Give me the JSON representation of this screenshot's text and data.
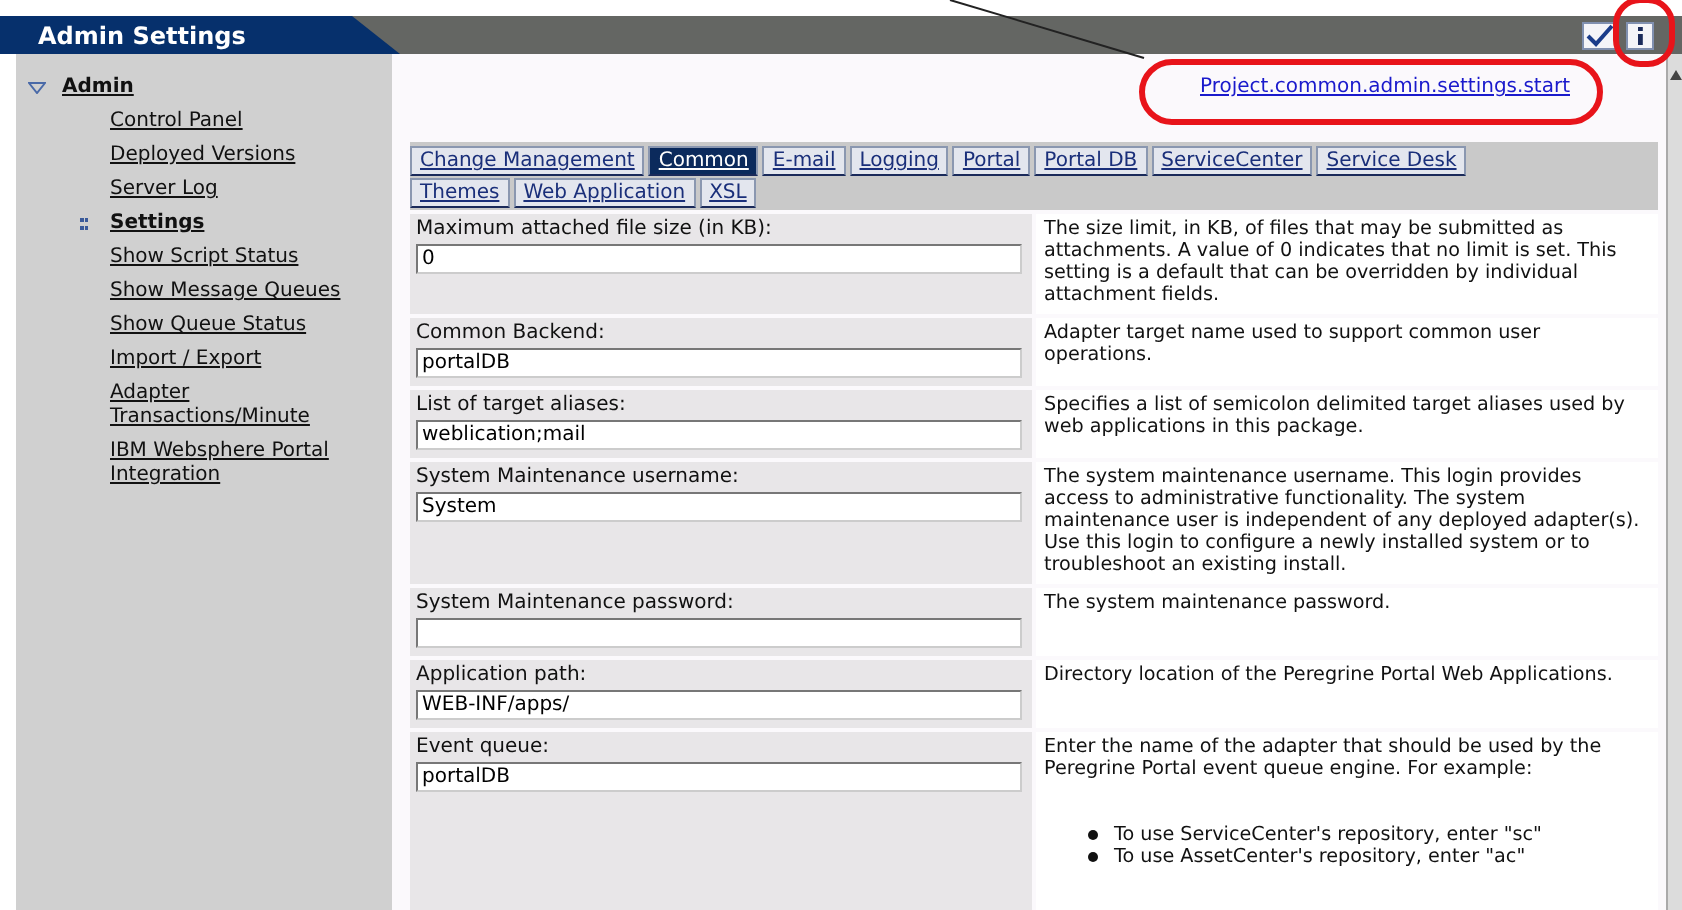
{
  "window": {
    "title": "Admin Settings"
  },
  "sidebar": {
    "section": {
      "label": "Admin",
      "expanded": true
    },
    "items": [
      {
        "label": "Control Panel",
        "selected": false
      },
      {
        "label": "Deployed Versions",
        "selected": false
      },
      {
        "label": "Server Log",
        "selected": false
      },
      {
        "label": "Settings",
        "selected": true
      },
      {
        "label": "Show Script Status",
        "selected": false
      },
      {
        "label": "Show Message Queues",
        "selected": false
      },
      {
        "label": "Show Queue Status",
        "selected": false
      },
      {
        "label": "Import / Export",
        "selected": false
      },
      {
        "label": "Adapter Transactions/Minute",
        "selected": false
      },
      {
        "label": "IBM Websphere Portal Integration",
        "selected": false
      }
    ]
  },
  "page_link": "Project.common.admin.settings.start",
  "tab_rows": [
    {
      "tabs": [
        {
          "label": "Change Management",
          "selected": false
        },
        {
          "label": "Common",
          "selected": true
        },
        {
          "label": "E-mail",
          "selected": false
        },
        {
          "label": "Logging",
          "selected": false
        },
        {
          "label": "Portal",
          "selected": false
        },
        {
          "label": "Portal DB",
          "selected": false
        },
        {
          "label": "ServiceCenter",
          "selected": false
        },
        {
          "label": "Service Desk",
          "selected": false
        }
      ]
    },
    {
      "tabs": [
        {
          "label": "Themes",
          "selected": false
        },
        {
          "label": "Web Application",
          "selected": false
        },
        {
          "label": "XSL",
          "selected": false
        }
      ]
    }
  ],
  "settings": [
    {
      "label": "Maximum attached file size (in KB):",
      "value": "0",
      "description": "The size limit, in KB, of files that may be submitted as attachments. A value of 0 indicates that no limit is set. This setting is a default that can be overridden by individual attachment fields."
    },
    {
      "label": "Common Backend:",
      "value": "portalDB",
      "description": "Adapter target name used to support common user operations."
    },
    {
      "label": "List of target aliases:",
      "value": "weblication;mail",
      "description": "Specifies a list of semicolon delimited target aliases used by web applications in this package."
    },
    {
      "label": "System Maintenance username:",
      "value": "System",
      "description": "The system maintenance username. This login provides access to administrative functionality. The system maintenance user is independent of any deployed adapter(s). Use this login to configure a newly installed system or to troubleshoot an existing install."
    },
    {
      "label": "System Maintenance password:",
      "description": "The system maintenance password."
    },
    {
      "label": "Application path:",
      "value": "WEB-INF/apps/",
      "description": "Directory location of the Peregrine Portal Web Applications."
    },
    {
      "label": "Event queue:",
      "value": "portalDB",
      "description": "Enter the name of the adapter that should be used by the Peregrine Portal event queue engine. For example:",
      "bullets": [
        "To use ServiceCenter's repository, enter \"sc\"",
        "To use AssetCenter's repository, enter \"ac\""
      ]
    }
  ]
}
